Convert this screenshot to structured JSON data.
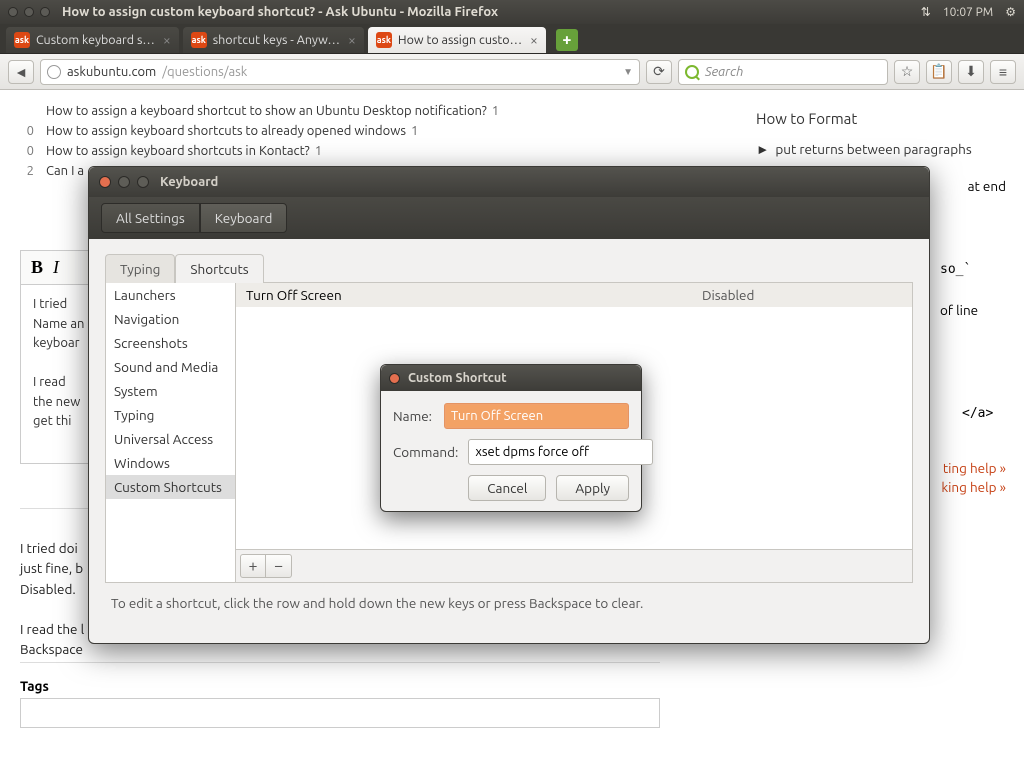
{
  "menubar": {
    "title": "How to assign custom keyboard shortcut? - Ask Ubuntu - Mozilla Firefox",
    "time": "10:07 PM"
  },
  "tabs": [
    {
      "label": "Custom keyboard s…",
      "active": false
    },
    {
      "label": "shortcut keys - Anyw…",
      "active": false
    },
    {
      "label": "How to assign custo…",
      "active": true
    }
  ],
  "url": {
    "host": "askubuntu.com",
    "path": "/questions/ask"
  },
  "search": {
    "placeholder": "Search"
  },
  "toolbar_icons": {
    "star": "☆",
    "clip": "📋",
    "down": "⬇",
    "menu": "≡"
  },
  "related": [
    {
      "count": "",
      "text": "How to assign a keyboard shortcut to show an Ubuntu Desktop notification?",
      "n": "1"
    },
    {
      "count": "0",
      "text": "How to assign keyboard shortcuts to already opened windows",
      "n": "1"
    },
    {
      "count": "0",
      "text": "How to assign keyboard shortcuts in Kontact?",
      "n": "1"
    },
    {
      "count": "2",
      "text": "Can I a",
      "n": ""
    }
  ],
  "format": {
    "heading": "How to Format",
    "bullet1": "put returns between paragraphs",
    "frag_end": "at end"
  },
  "editor": {
    "line1": "I tried",
    "line2": "Name an",
    "line3": "keyboar",
    "line4": "",
    "line5": "I read ",
    "line6": "the new",
    "line7": "get thi"
  },
  "side_frag": {
    "so": "so_`",
    "ofline": "of line",
    "closea": "</a>"
  },
  "help": {
    "l1": "ting help »",
    "l2": "king help »"
  },
  "preview": {
    "p1": "I tried doi",
    "p2": "just fine, b",
    "p3": "Disabled.",
    "p4": "I read the l",
    "p5": "Backspace"
  },
  "tags": {
    "label": "Tags"
  },
  "kb": {
    "title": "Keyboard",
    "crumbs": [
      "All Settings",
      "Keyboard"
    ],
    "tabs": [
      "Typing",
      "Shortcuts"
    ],
    "categories": [
      "Launchers",
      "Navigation",
      "Screenshots",
      "Sound and Media",
      "System",
      "Typing",
      "Universal Access",
      "Windows",
      "Custom Shortcuts"
    ],
    "row": {
      "name": "Turn Off Screen",
      "key": "Disabled"
    },
    "add": "+",
    "remove": "−",
    "hint": "To edit a shortcut, click the row and hold down the new keys or press Backspace to clear."
  },
  "dlg": {
    "title": "Custom Shortcut",
    "name_label": "Name:",
    "name_value": "Turn Off Screen",
    "cmd_label": "Command:",
    "cmd_value": "xset dpms force off",
    "cancel": "Cancel",
    "apply": "Apply"
  }
}
